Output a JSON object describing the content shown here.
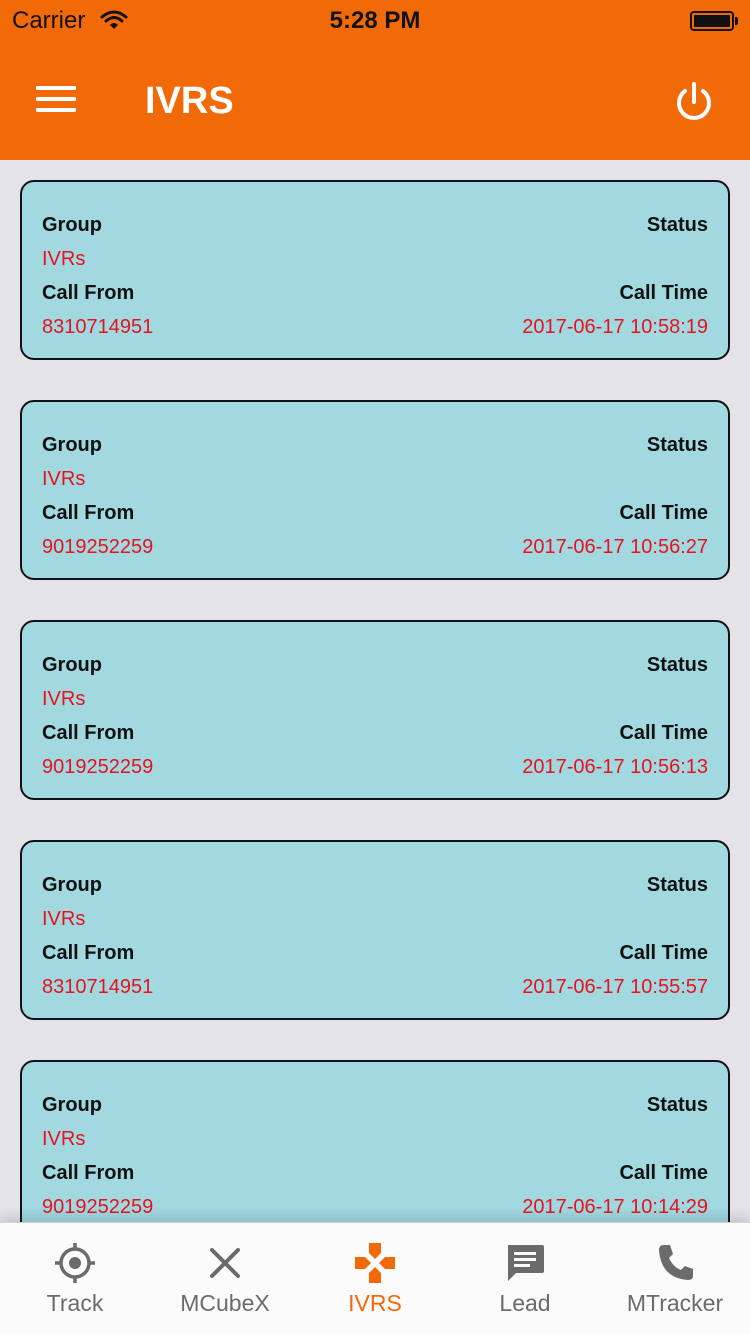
{
  "status_bar": {
    "carrier": "Carrier",
    "time": "5:28 PM"
  },
  "header": {
    "title": "IVRS",
    "menu_icon": "hamburger-menu-icon",
    "power_icon": "power-icon"
  },
  "card_labels": {
    "group": "Group",
    "status": "Status",
    "call_from": "Call From",
    "call_time": "Call Time"
  },
  "records": [
    {
      "group": "IVRs",
      "status": "",
      "call_from": "8310714951",
      "call_time": "2017-06-17 10:58:19"
    },
    {
      "group": "IVRs",
      "status": "",
      "call_from": "9019252259",
      "call_time": "2017-06-17 10:56:27"
    },
    {
      "group": "IVRs",
      "status": "",
      "call_from": "9019252259",
      "call_time": "2017-06-17 10:56:13"
    },
    {
      "group": "IVRs",
      "status": "",
      "call_from": "8310714951",
      "call_time": "2017-06-17 10:55:57"
    },
    {
      "group": "IVRs",
      "status": "",
      "call_from": "9019252259",
      "call_time": "2017-06-17 10:14:29"
    }
  ],
  "tabs": [
    {
      "label": "Track",
      "icon": "target-icon",
      "active": false
    },
    {
      "label": "MCubeX",
      "icon": "close-x-icon",
      "active": false
    },
    {
      "label": "IVRS",
      "icon": "dpad-cross-icon",
      "active": true
    },
    {
      "label": "Lead",
      "icon": "chat-bubble-icon",
      "active": false
    },
    {
      "label": "MTracker",
      "icon": "phone-icon",
      "active": false
    }
  ],
  "colors": {
    "accent": "#f26a08",
    "card_bg": "#a2d8e0",
    "value_red": "#e8121e",
    "page_bg": "#e4e3ea"
  }
}
